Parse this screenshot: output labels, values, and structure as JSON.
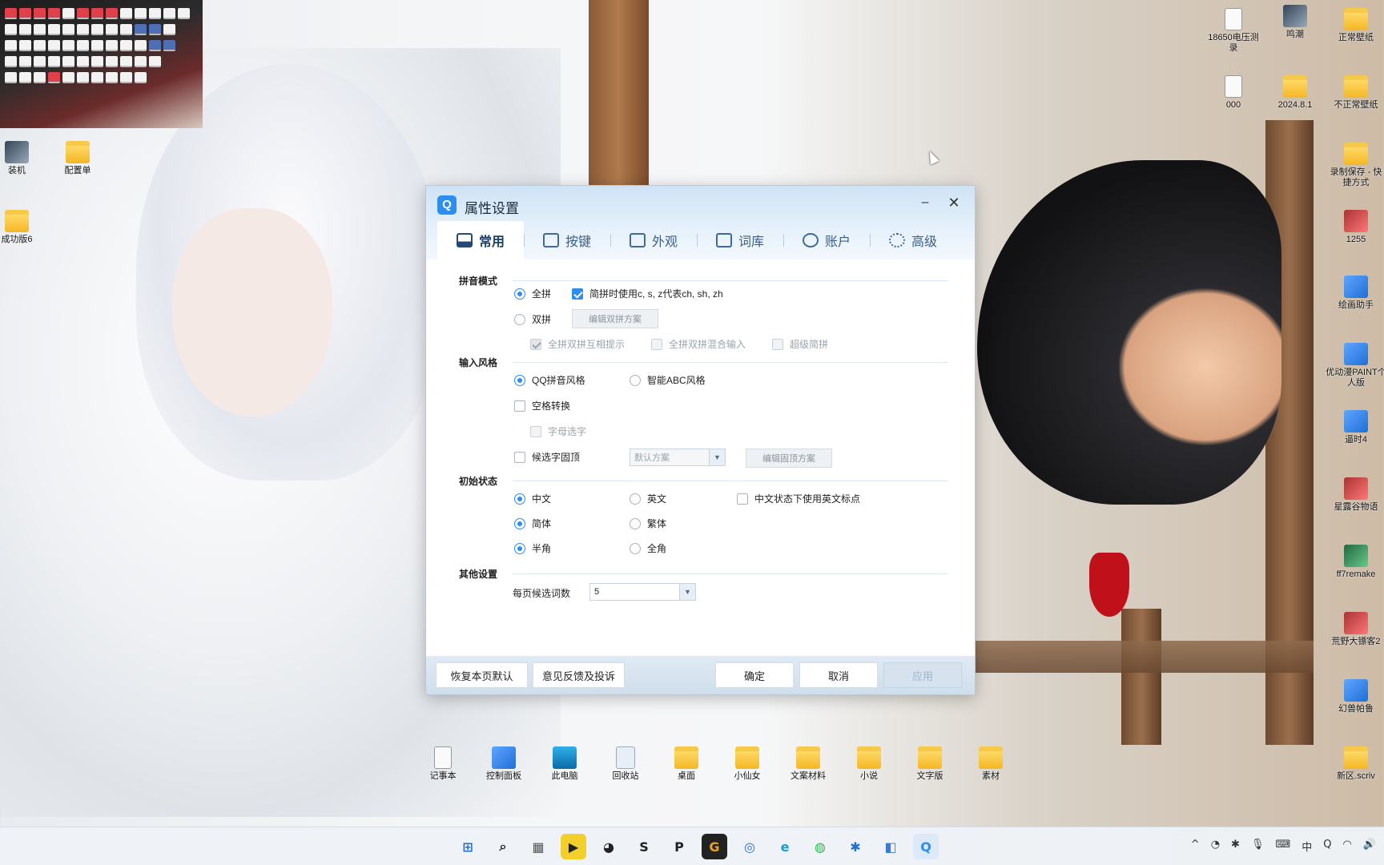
{
  "desktop": {
    "left_icons": [
      {
        "label": "装机",
        "icon": "screen-shot-icon"
      },
      {
        "label": "配置单",
        "icon": "folder-icon"
      },
      {
        "label": "成功版6",
        "icon": "folder-icon"
      }
    ],
    "right_icons": [
      {
        "label": "18650电压测录",
        "icon": "text-file-icon"
      },
      {
        "label": "鸣潮",
        "icon": "game-icon"
      },
      {
        "label": "正常壁纸",
        "icon": "folder-icon"
      },
      {
        "label": "000",
        "icon": "text-file-icon"
      },
      {
        "label": "2024.8.1",
        "icon": "folder-icon"
      },
      {
        "label": "不正常壁纸",
        "icon": "folder-icon"
      },
      {
        "label": "录制保存 - 快捷方式",
        "icon": "shortcut-icon"
      },
      {
        "label": "1255",
        "icon": "image-icon"
      },
      {
        "label": "绘画助手",
        "icon": "app-icon"
      },
      {
        "label": "优动漫PAINT个人版",
        "icon": "app-icon"
      },
      {
        "label": "逼时4",
        "icon": "app-icon"
      },
      {
        "label": "星露谷物语",
        "icon": "game-icon"
      },
      {
        "label": "ff7remake",
        "icon": "game-icon"
      },
      {
        "label": "荒野大镖客2",
        "icon": "game-icon"
      },
      {
        "label": "幻兽帕鲁",
        "icon": "game-icon"
      },
      {
        "label": "新区.scriv",
        "icon": "folder-icon"
      }
    ],
    "bottom_icons": [
      {
        "label": "记事本",
        "icon": "notepad-icon"
      },
      {
        "label": "控制面板",
        "icon": "control-panel-icon"
      },
      {
        "label": "此电脑",
        "icon": "computer-icon"
      },
      {
        "label": "回收站",
        "icon": "recycle-bin-icon"
      },
      {
        "label": "桌面",
        "icon": "folder-icon"
      },
      {
        "label": "小仙女",
        "icon": "folder-icon"
      },
      {
        "label": "文案材料",
        "icon": "folder-icon"
      },
      {
        "label": "小说",
        "icon": "folder-icon"
      },
      {
        "label": "文字版",
        "icon": "folder-icon"
      },
      {
        "label": "素材",
        "icon": "folder-icon"
      }
    ]
  },
  "dialog": {
    "logo": "Q",
    "title": "属性设置",
    "minimize": "–",
    "close": "✕",
    "tabs": [
      {
        "label": "常用",
        "icon": "monitor-icon",
        "active": true
      },
      {
        "label": "按键",
        "icon": "key-icon",
        "active": false
      },
      {
        "label": "外观",
        "icon": "shirt-icon",
        "active": false
      },
      {
        "label": "词库",
        "icon": "book-icon",
        "active": false
      },
      {
        "label": "账户",
        "icon": "user-icon",
        "active": false
      },
      {
        "label": "高级",
        "icon": "gear-icon",
        "active": false
      }
    ],
    "sections": {
      "pinyin": {
        "title": "拼音模式",
        "quanpin": "全拼",
        "jianpin_czs": "简拼时使用c, s, z代表ch, sh, zh",
        "shuangpin": "双拼",
        "edit_shuangpin": "编辑双拼方案",
        "hint": "全拼双拼互相提示",
        "mixed": "全拼双拼混合输入",
        "super_jianpin": "超级简拼"
      },
      "style": {
        "title": "输入风格",
        "qq_style": "QQ拼音风格",
        "abc_style": "智能ABC风格",
        "space_convert": "空格转换",
        "letter_select": "字母选字",
        "candidate_pin": "候选字固顶",
        "scheme_select": "默认方案",
        "edit_pin": "编辑固顶方案"
      },
      "initial": {
        "title": "初始状态",
        "chinese": "中文",
        "english": "英文",
        "en_punct": "中文状态下使用英文标点",
        "simplified": "简体",
        "traditional": "繁体",
        "halfwidth": "半角",
        "fullwidth": "全角"
      },
      "other": {
        "title": "其他设置",
        "per_page_label": "每页候选词数",
        "per_page_value": "5"
      }
    },
    "footer": {
      "restore": "恢复本页默认",
      "feedback": "意见反馈及投诉",
      "ok": "确定",
      "cancel": "取消",
      "apply": "应用"
    }
  },
  "taskbar": {
    "apps": [
      {
        "name": "start",
        "glyph": "⊞",
        "color": "#1f6fd6"
      },
      {
        "name": "search",
        "glyph": "⌕",
        "color": "#222"
      },
      {
        "name": "calculator",
        "glyph": "▦",
        "color": "#555"
      },
      {
        "name": "potplayer",
        "glyph": "▶",
        "color": "#d6a800"
      },
      {
        "name": "panda",
        "glyph": "◕",
        "color": "#222"
      },
      {
        "name": "steam-like",
        "glyph": "S",
        "color": "#222"
      },
      {
        "name": "p-app",
        "glyph": "P",
        "color": "#222"
      },
      {
        "name": "g-app",
        "glyph": "G",
        "color": "#e8a21f"
      },
      {
        "name": "browser",
        "glyph": "◎",
        "color": "#2b6fd6"
      },
      {
        "name": "edge",
        "glyph": "e",
        "color": "#1b9bd0"
      },
      {
        "name": "wechat",
        "glyph": "◍",
        "color": "#2dbb4a"
      },
      {
        "name": "star-app",
        "glyph": "✱",
        "color": "#1f6fd6"
      },
      {
        "name": "settings-app",
        "glyph": "◧",
        "color": "#3a7bd5"
      },
      {
        "name": "qq-pinyin",
        "glyph": "Q",
        "color": "#2b8ef0"
      }
    ],
    "tray": [
      "^",
      "◔",
      "✱",
      "🎙",
      "⌨",
      "中",
      "Q",
      "◠",
      "🔊"
    ]
  }
}
